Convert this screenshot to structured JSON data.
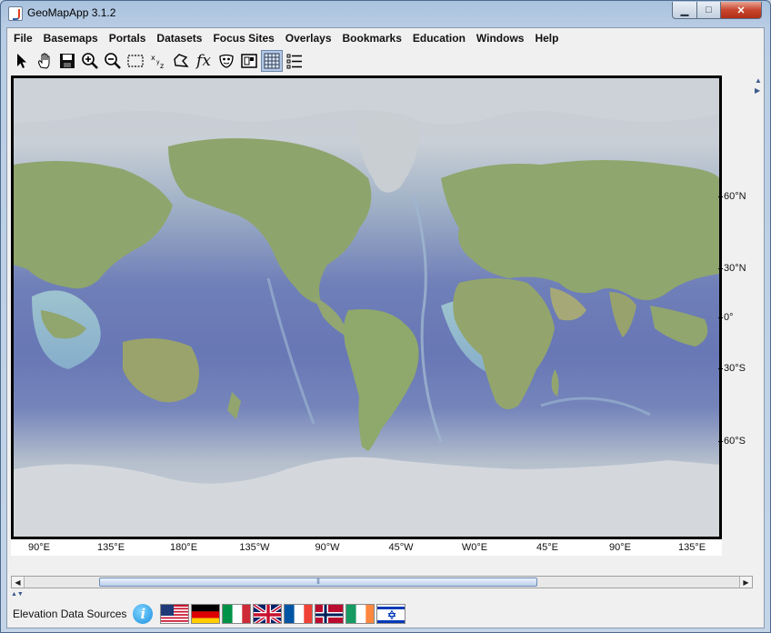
{
  "window": {
    "title": "GeoMapApp 3.1.2",
    "min_label": "▁",
    "max_label": "□",
    "close_label": "✕"
  },
  "menu": [
    "File",
    "Basemaps",
    "Portals",
    "Datasets",
    "Focus Sites",
    "Overlays",
    "Bookmarks",
    "Education",
    "Windows",
    "Help"
  ],
  "toolbar": {
    "tools": [
      {
        "name": "select-arrow-icon",
        "glyph": "↖"
      },
      {
        "name": "pan-hand-icon",
        "glyph": "✋"
      },
      {
        "name": "save-disk-icon",
        "glyph": "💾"
      },
      {
        "name": "zoom-in-icon",
        "glyph": "⊕"
      },
      {
        "name": "zoom-out-icon",
        "glyph": "⊖"
      },
      {
        "name": "rectangle-select-icon",
        "glyph": "⬚"
      },
      {
        "name": "xyz-icon",
        "glyph": "xz"
      },
      {
        "name": "lasso-icon",
        "glyph": "⌒"
      },
      {
        "name": "function-icon",
        "glyph": "fx"
      },
      {
        "name": "mask-icon",
        "glyph": "☺"
      },
      {
        "name": "frame-icon",
        "glyph": "▣"
      },
      {
        "name": "grid-icon",
        "glyph": "▦"
      },
      {
        "name": "list-icon",
        "glyph": "☰"
      }
    ],
    "fx_label": "fx"
  },
  "map": {
    "lat_labels": [
      "60°N",
      "30°N",
      "0°",
      "30°S",
      "60°S"
    ],
    "lon_labels": [
      "90°E",
      "135°E",
      "180°E",
      "135°W",
      "90°W",
      "45°W",
      "W0°E",
      "45°E",
      "90°E",
      "135°E"
    ],
    "colors": {
      "ocean_deep": "#6877b5",
      "ocean_shallow": "#8fb6cc",
      "land": "#8fa86d",
      "ice": "#d2d6dc"
    }
  },
  "statusbar": {
    "label": "Elevation Data Sources",
    "info_glyph": "i",
    "flags": [
      "usa-flag-icon",
      "germany-flag-icon",
      "italy-flag-icon",
      "uk-flag-icon",
      "france-flag-icon",
      "norway-flag-icon",
      "ireland-flag-icon",
      "israel-flag-icon"
    ]
  }
}
